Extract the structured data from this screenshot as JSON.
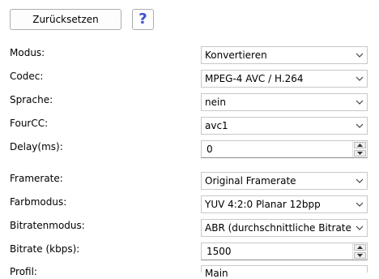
{
  "toolbar": {
    "reset_label": "Zurücksetzen",
    "help_label": "?"
  },
  "fields": [
    {
      "label": "Modus:",
      "value": "Konvertieren",
      "type": "combo"
    },
    {
      "label": "Codec:",
      "value": "MPEG-4 AVC / H.264",
      "type": "combo"
    },
    {
      "label": "Sprache:",
      "value": "nein",
      "type": "combo"
    },
    {
      "label": "FourCC:",
      "value": "avc1",
      "type": "combo"
    },
    {
      "label": "Delay(ms):",
      "value": "0",
      "type": "spin"
    },
    {
      "label": "Framerate:",
      "value": "Original Framerate",
      "type": "combo"
    },
    {
      "label": "Farbmodus:",
      "value": "YUV 4:2:0 Planar 12bpp",
      "type": "combo"
    },
    {
      "label": "Bitratenmodus:",
      "value": "ABR (durchschnittliche Bitrate)",
      "type": "combo"
    },
    {
      "label": "Bitrate (kbps):",
      "value": "1500",
      "type": "spin"
    },
    {
      "label": "Profil:",
      "value": "Main",
      "type": "spin"
    }
  ],
  "colors": {
    "help_icon": "#3b4fd0",
    "border": "#c8c8c8"
  }
}
